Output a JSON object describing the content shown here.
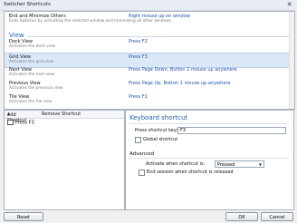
{
  "window": {
    "title": "Switcher Shortcuts",
    "close_glyph": "✕"
  },
  "commands": {
    "section": "View",
    "rows": [
      {
        "name": "End and Minimize Others",
        "desc": "Ends Switcher by activating the selected window and minimizing all other windows",
        "shortcut": "Right mouse up on window"
      },
      {
        "name": "Dock View",
        "desc": "Activates the dock view",
        "shortcut": "Press F2"
      },
      {
        "name": "Grid View",
        "desc": "Activates the grid view",
        "shortcut": "Press F3"
      },
      {
        "name": "Next View",
        "desc": "Activates the next view",
        "shortcut": "Press Page Down, Button 2 mouse up anywhere"
      },
      {
        "name": "Previous View",
        "desc": "Activates the previous view",
        "shortcut": "Press Page Up, Button 1 mouse up anywhere"
      },
      {
        "name": "Tile View",
        "desc": "Activates the tile view",
        "shortcut": "Press F1"
      }
    ]
  },
  "left_panel": {
    "add_shortcut": "Add Shortcut",
    "add_arrow": "▾",
    "remove_shortcut": "Remove Shortcut",
    "items": [
      {
        "label": "Press F3"
      }
    ]
  },
  "right_panel": {
    "title": "Keyboard shortcut",
    "press_keys_label": "Press shortcut keys:",
    "press_keys_value": "F3",
    "global_shortcut": "Global shortcut",
    "advanced": "Advanced",
    "activate_label": "Activate when shortcut is:",
    "activate_value": "Pressed",
    "dropdown_arrow": "▼",
    "end_session": "End session when shortcut is released"
  },
  "buttons": {
    "reset": "Reset",
    "ok": "OK",
    "cancel": "Cancel"
  }
}
